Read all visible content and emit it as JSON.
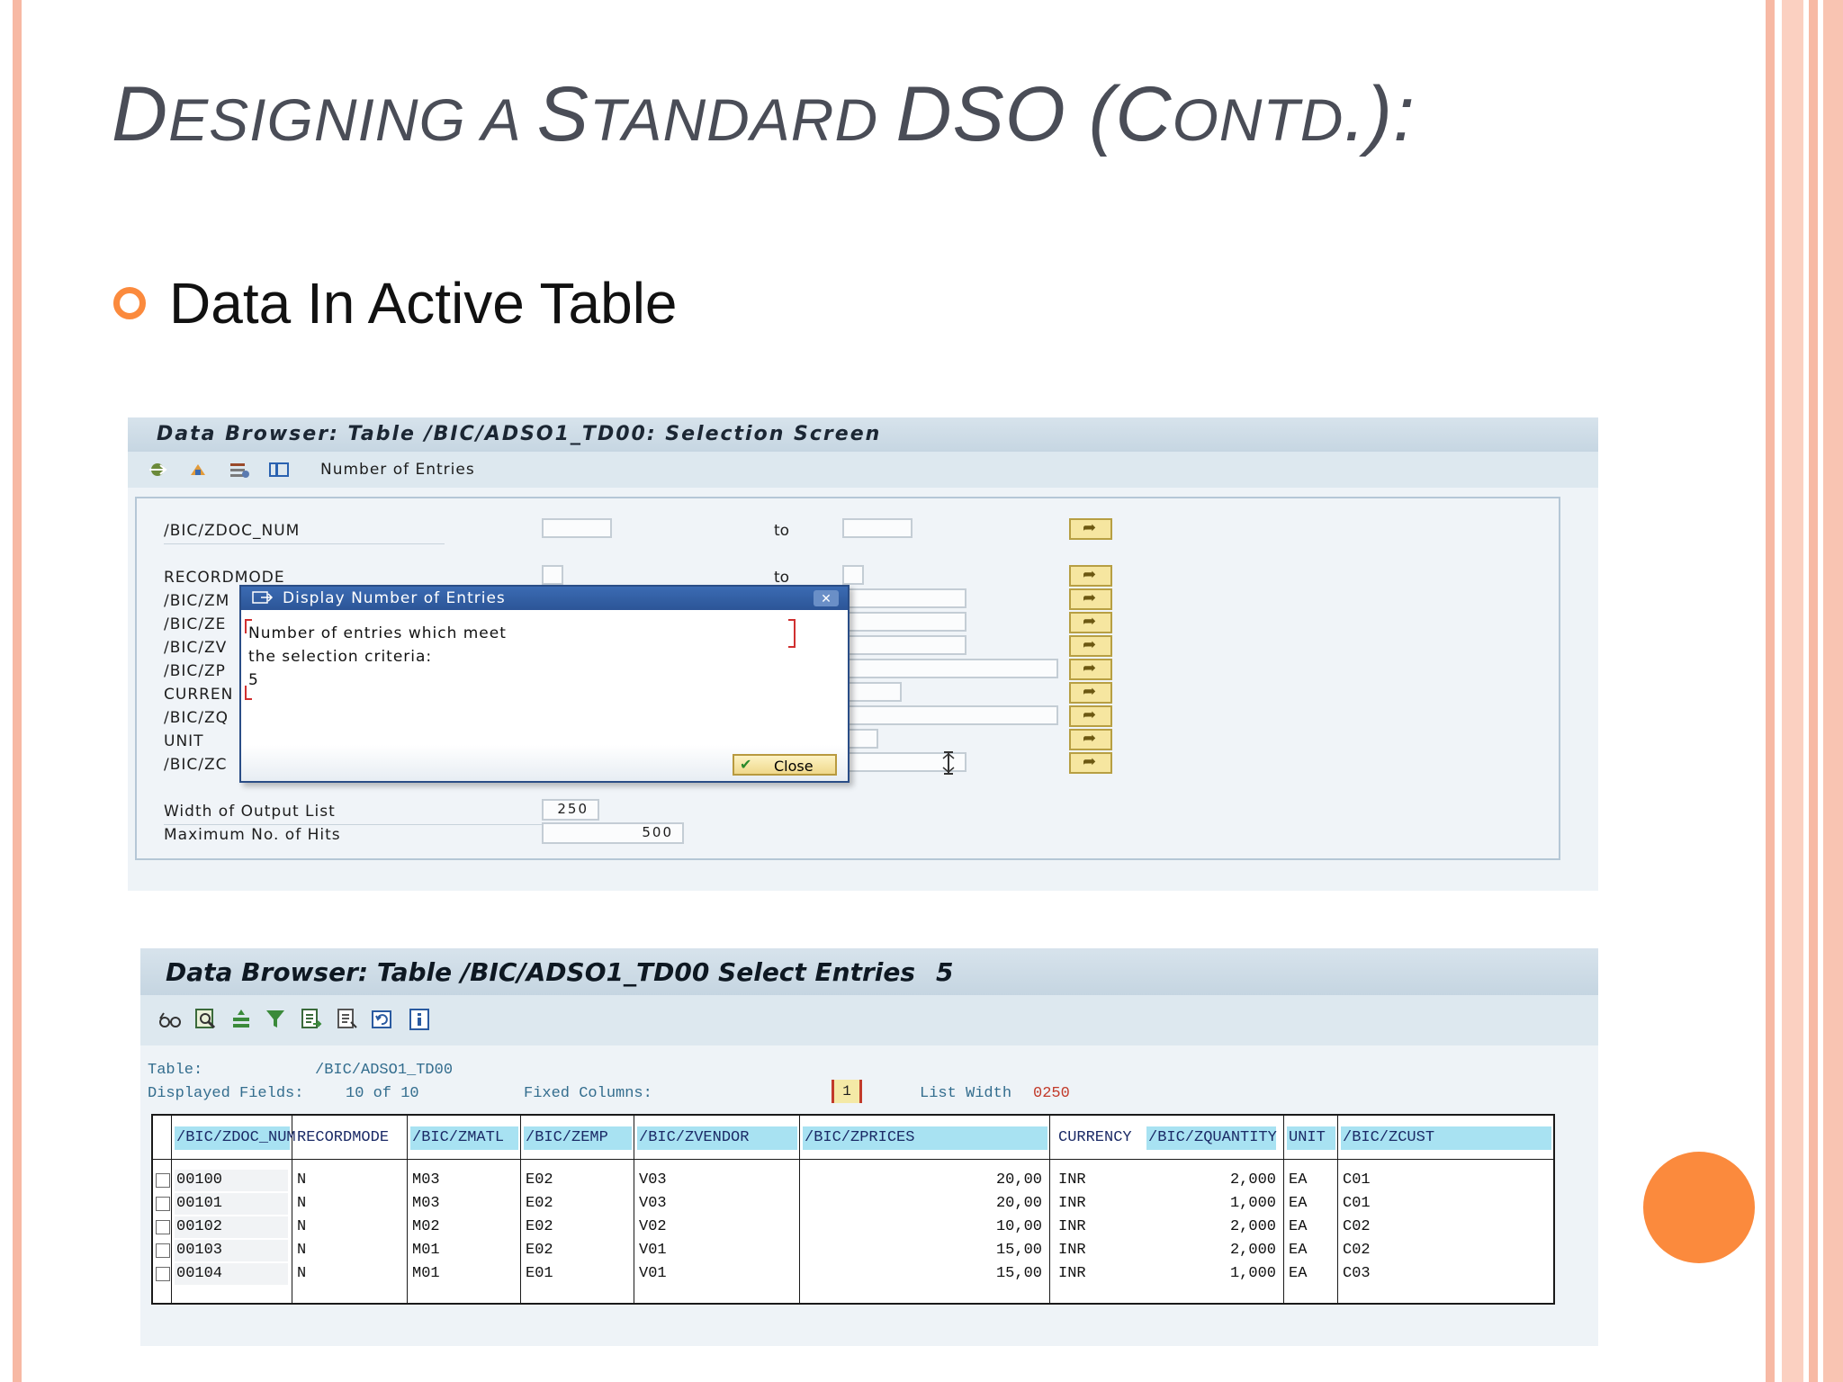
{
  "slide": {
    "title_parts": [
      "D",
      "ESIGNING A ",
      "S",
      "TANDARD ",
      "DSO (C",
      "ONTD",
      ".):"
    ],
    "bullet": "Data In Active Table"
  },
  "selection_screen": {
    "title": "Data Browser: Table /BIC/ADSO1_TD00: Selection Screen",
    "toolbar_label": "Number of Entries",
    "fields": [
      {
        "label": "/BIC/ZDOC_NUM"
      },
      {
        "label": "RECORDMODE"
      },
      {
        "label": "/BIC/ZM"
      },
      {
        "label": "/BIC/ZE"
      },
      {
        "label": "/BIC/ZV"
      },
      {
        "label": "/BIC/ZP"
      },
      {
        "label": "CURREN"
      },
      {
        "label": "/BIC/ZQ"
      },
      {
        "label": "UNIT"
      },
      {
        "label": "/BIC/ZC"
      }
    ],
    "to_label": "to",
    "width_label": "Width of Output List",
    "width_value": "250",
    "maxhits_label": "Maximum No. of Hits",
    "maxhits_value": "500",
    "dialog": {
      "title": "Display Number of Entries",
      "line1": "Number of entries which meet",
      "line2": "the selection criteria:",
      "count": "5",
      "close_label": "Close",
      "close_glyph": "✕"
    }
  },
  "entries_screen": {
    "title": "Data Browser: Table /BIC/ADSO1_TD00 Select Entries",
    "count": "5",
    "table_label": "Table:",
    "table_name": "/BIC/ADSO1_TD00",
    "displayed_label": "Displayed Fields:",
    "displayed_value": "10 of  10",
    "fixed_label": "Fixed Columns:",
    "fixed_value": "1",
    "listwidth_label": "List Width",
    "listwidth_value": "0250",
    "columns": [
      "/BIC/ZDOC_NUM",
      "RECORDMODE",
      "/BIC/ZMATL",
      "/BIC/ZEMP",
      "/BIC/ZVENDOR",
      "/BIC/ZPRICES",
      "CURRENCY",
      "/BIC/ZQUANTITY",
      "UNIT",
      "/BIC/ZCUST"
    ],
    "rows": [
      [
        "00100",
        "N",
        "M03",
        "E02",
        "V03",
        "20,00",
        "INR",
        "2,000",
        "EA",
        "C01"
      ],
      [
        "00101",
        "N",
        "M03",
        "E02",
        "V03",
        "20,00",
        "INR",
        "1,000",
        "EA",
        "C01"
      ],
      [
        "00102",
        "N",
        "M02",
        "E02",
        "V02",
        "10,00",
        "INR",
        "2,000",
        "EA",
        "C02"
      ],
      [
        "00103",
        "N",
        "M01",
        "E02",
        "V01",
        "15,00",
        "INR",
        "2,000",
        "EA",
        "C02"
      ],
      [
        "00104",
        "N",
        "M01",
        "E01",
        "V01",
        "15,00",
        "INR",
        "1,000",
        "EA",
        "C03"
      ]
    ]
  },
  "icons": {
    "execute": "execute-icon",
    "save_variant": "save-variant-icon",
    "get_variant": "get-variant-icon",
    "layout": "layout-icon"
  }
}
